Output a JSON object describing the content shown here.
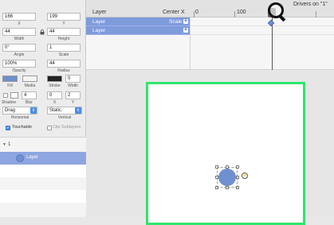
{
  "inspector": {
    "x_value": "166",
    "y_value": "199",
    "x_label": "X",
    "y_label": "Y",
    "width_value": "44",
    "height_value": "44",
    "width_label": "Width",
    "height_label": "Height",
    "angle_value": "0°",
    "scale_value": "1",
    "angle_label": "Angle",
    "scale_label": "Scale",
    "opacity_value": "100%",
    "radius_value": "44",
    "opacity_label": "Opacity",
    "radius_label": "Radius",
    "fill_label": "Fill",
    "media_label": "Media",
    "stroke_label": "Stroke",
    "stroke_width_value": "0",
    "stroke_width_label": "Width",
    "shadow_label": "Shadow",
    "blur_value": "4",
    "blur_label": "Blur",
    "shadow_x_value": "0",
    "shadow_y_value": "2",
    "shadow_x_label": "X",
    "shadow_y_label": "Y",
    "horizontal_value": "Drag",
    "horizontal_label": "Horizontal",
    "vertical_value": "Static",
    "vertical_label": "Vertical",
    "touchable_label": "Touchable",
    "clip_label": "Clip Sublayers",
    "fill_color": "#6f8fd0",
    "stroke_color": "#222222"
  },
  "layer_tree": {
    "root_label": "1",
    "layer_label": "Layer"
  },
  "drivers": {
    "title": "Drivers on \"1\"",
    "col_layer": "Layer",
    "col_property": "Center X",
    "ruler_0": "0",
    "ruler_100": "100",
    "rows": [
      {
        "layer": "Layer",
        "property": "Scale"
      },
      {
        "layer": "Layer",
        "property": ""
      }
    ]
  },
  "colors": {
    "artboard_border": "#2ee66a",
    "selection": "#7e9bdc",
    "circle": "#6f8fd0"
  }
}
